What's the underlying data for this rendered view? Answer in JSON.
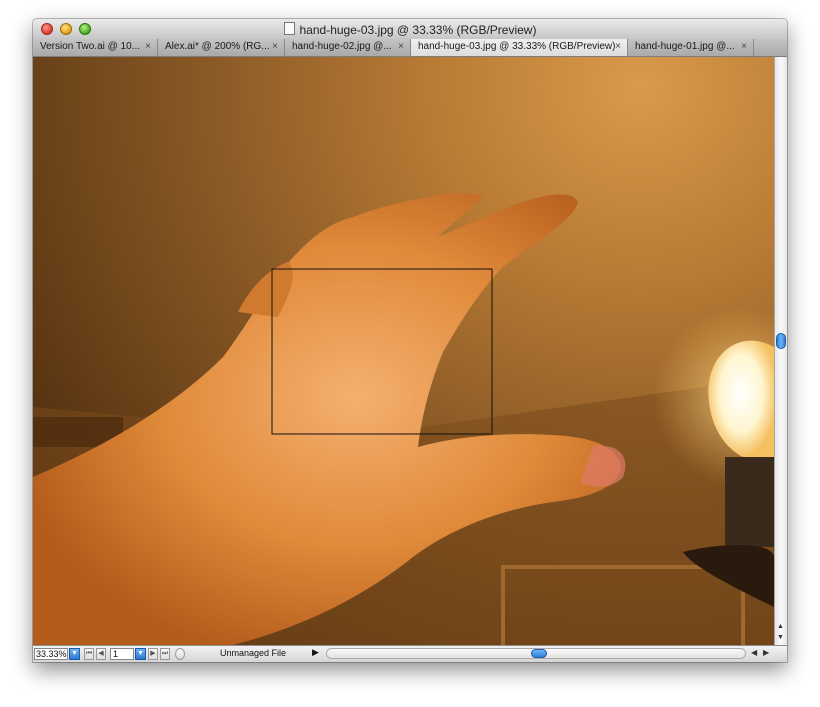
{
  "window": {
    "title": "hand-huge-03.jpg @ 33.33% (RGB/Preview)"
  },
  "tabs": [
    {
      "label": "Version Two.ai @ 10...",
      "close": "×",
      "active": false
    },
    {
      "label": "Alex.ai* @ 200% (RG...",
      "close": "×",
      "active": false
    },
    {
      "label": "hand-huge-02.jpg @...",
      "close": "×",
      "active": false
    },
    {
      "label": "hand-huge-03.jpg @ 33.33% (RGB/Preview)",
      "close": "×",
      "active": true
    },
    {
      "label": "hand-huge-01.jpg @...",
      "close": "×",
      "active": false
    }
  ],
  "statusbar": {
    "zoom": "33.33%",
    "page": "1",
    "file_status": "Unmanaged File"
  },
  "icons": {
    "dropdown": "▼",
    "first": "⏮",
    "prev": "◀",
    "next": "▶",
    "last": "⏭",
    "menu_arrow": "▶",
    "scroll_up": "▲",
    "scroll_down": "▼",
    "scroll_left": "◀",
    "scroll_right": "▶"
  },
  "colors": {
    "accent": "#2f7fd8",
    "selection_box": "#111111"
  }
}
